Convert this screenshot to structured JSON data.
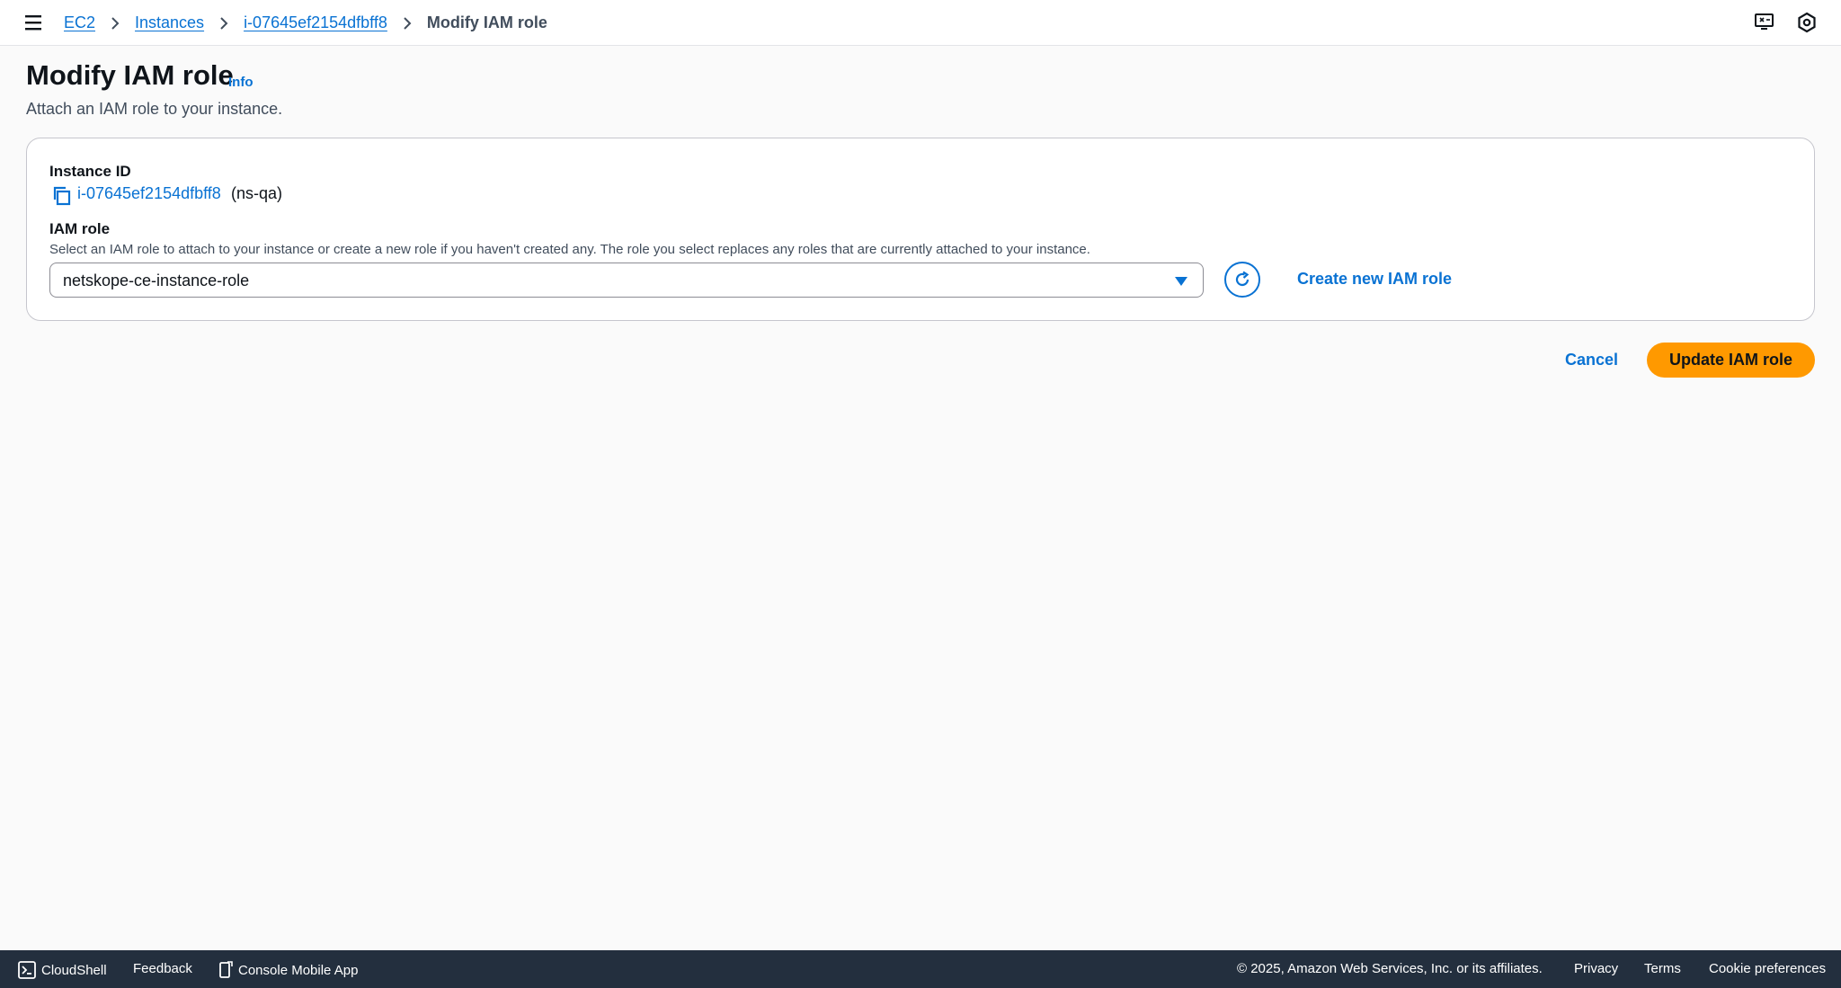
{
  "breadcrumb": {
    "items": [
      "EC2",
      "Instances",
      "i-07645ef2154dfbff8"
    ],
    "current": "Modify IAM role"
  },
  "header": {
    "title": "Modify IAM role",
    "info_label": "Info",
    "description": "Attach an IAM role to your instance."
  },
  "form": {
    "instance_id_label": "Instance ID",
    "instance_id": "i-07645ef2154dfbff8",
    "instance_name": "(ns-qa)",
    "iam_role_label": "IAM role",
    "iam_role_description": "Select an IAM role to attach to your instance or create a new role if you haven't created any. The role you select replaces any roles that are currently attached to your instance.",
    "iam_role_selected": "netskope-ce-instance-role",
    "create_role_label": "Create new IAM role"
  },
  "actions": {
    "cancel_label": "Cancel",
    "submit_label": "Update IAM role"
  },
  "footer": {
    "cloudshell": "CloudShell",
    "feedback": "Feedback",
    "mobile_app": "Console Mobile App",
    "copyright": "© 2025, Amazon Web Services, Inc. or its affiliates.",
    "privacy": "Privacy",
    "terms": "Terms",
    "cookies": "Cookie preferences"
  },
  "colors": {
    "link": "#0972d3",
    "primary_button": "#ff9900",
    "footer_bg": "#232f3e"
  }
}
